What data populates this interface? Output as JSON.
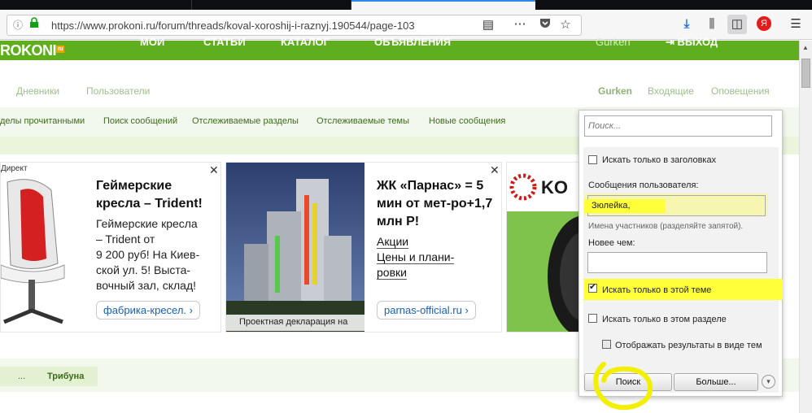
{
  "browser": {
    "url": "https://www.prokoni.ru/forum/threads/koval-xoroshij-i-raznyj.190544/page-103",
    "yandex_badge": "Я"
  },
  "site": {
    "logo": "ROKONI",
    "logo_suffix": "ru",
    "top_nav": [
      "МОИ",
      "СТАТЬИ",
      "КАТАЛОГ",
      "ОБЪЯВЛЕНИЯ"
    ],
    "user_name_top": "Gurken",
    "logout": "ВЫХОД",
    "subnav_left": [
      "Дневники",
      "Пользователи"
    ],
    "subnav_right": [
      "Gurken",
      "Входящие",
      "Оповещения"
    ],
    "links": [
      "делы прочитанными",
      "Поиск сообщений",
      "Отслеживаемые разделы",
      "Отслеживаемые темы",
      "Новые сообщения"
    ]
  },
  "ads": [
    {
      "source_label": "Директ",
      "title": "Геймерские кресла – Trident!",
      "text_lines": [
        "Геймерские кресла",
        "– Trident от",
        "9 200 руб! На Киев-",
        "ской ул. 5! Выста-",
        "вочный зал, склад!"
      ],
      "button": "фабрика-кресел."
    },
    {
      "image_caption": "Проектная декларация на",
      "title": "ЖК «Парнас» = 5 мин от мет-ро+1,7 млн Р!",
      "links": [
        "Акции",
        "Цены и плани-ровки"
      ],
      "button": "parnas-official.ru"
    },
    {
      "brand": "KO"
    }
  ],
  "breadcrumb": [
    "...",
    "Трибуна"
  ],
  "search_popup": {
    "search_placeholder": "Поиск...",
    "titles_only": "Искать только в заголовках",
    "users_label": "Сообщения пользователя:",
    "users_value": "Зюлейка,",
    "users_hint": "Имена участников (разделяйте запятой).",
    "newer_than": "Новее чем:",
    "this_thread_only": "Искать только в этой теме",
    "this_forum_only": "Искать только в этом разделе",
    "as_threads": "Отображать результаты в виде тем",
    "search_button": "Поиск",
    "more_button": "Больше...",
    "checkboxes": {
      "titles_only": false,
      "this_thread_only": true,
      "this_forum_only": false,
      "as_threads": false
    }
  },
  "colors": {
    "brand_green": "#5fae1e",
    "highlight": "#ffff3a"
  }
}
